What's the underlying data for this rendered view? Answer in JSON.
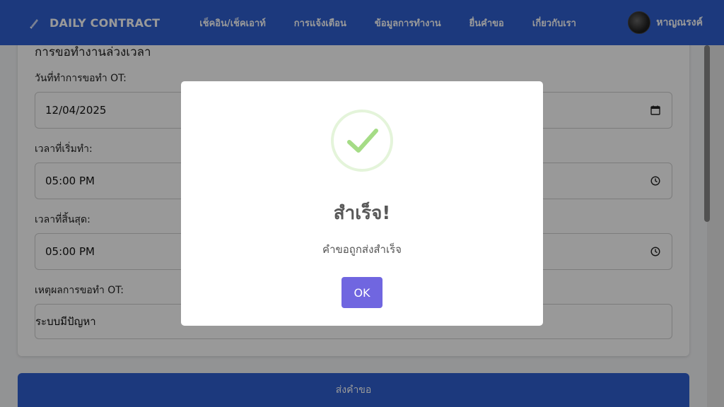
{
  "navbar": {
    "brand": "DAILY CONTRACT",
    "links": [
      "เช็คอิน/เช็คเอาท์",
      "การแจ้งเตือน",
      "ข้อมูลการทำงาน",
      "ยื่นคำขอ",
      "เกี่ยวกับเรา"
    ],
    "user_name": "หาญณรงค์"
  },
  "form": {
    "title": "การขอทำงานล่วงเวลา",
    "date_label": "วันที่ทำการขอทำ OT:",
    "date_value": "12/04/2025",
    "start_label": "เวลาที่เริ่มทำ:",
    "start_value": "05:00 PM",
    "end_label": "เวลาที่สิ้นสุด:",
    "end_value": "05:00 PM",
    "reason_label": "เหตุผลการขอทำ OT:",
    "reason_value": "ระบบมีปัญหา",
    "submit_label": "ส่งคำขอ"
  },
  "modal": {
    "title": "สำเร็จ!",
    "message": "คำขอถูกส่งสำเร็จ",
    "ok_label": "OK"
  }
}
